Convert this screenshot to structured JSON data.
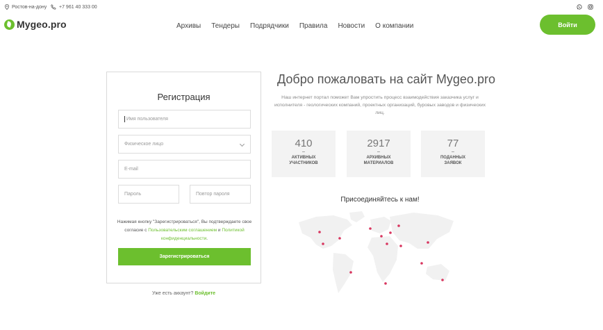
{
  "topbar": {
    "city": "Ростов-на-дону",
    "phone": "+7 961 40 333 00",
    "socials": [
      "whatsapp-icon",
      "instagram-icon"
    ]
  },
  "header": {
    "logo_text": "Mygeo.pro",
    "nav": [
      "Архивы",
      "Тендеры",
      "Подрядчики",
      "Правила",
      "Новости",
      "О компании"
    ],
    "login_label": "Войти"
  },
  "registration": {
    "title": "Регистрация",
    "username_placeholder": "Имя пользователя",
    "type_value": "Физическое лицо",
    "email_placeholder": "E-mail",
    "password_placeholder": "Пароль",
    "password_repeat_placeholder": "Повтор пароля",
    "agree_prefix": "Нажимая кнопку \"Зарегистрироваться\", Вы подтверждаете свое согласие с ",
    "agree_link1": "Пользовательским соглашением",
    "agree_mid": " и ",
    "agree_link2": "Политикой конфиденциальности",
    "agree_suffix": ".",
    "submit_label": "Зарегистрироваться",
    "have_account": "Уже есть аккаунт?",
    "login_link": "Войдите"
  },
  "welcome": {
    "title": "Добро пожаловать на сайт Mygeo.pro",
    "description": "Наш интернет портал поможет Вам упростить процесс взаимодействия заказчика услуг и исполнителя - геологических компаний, проектных организаций, буровых заводов и физических лиц.",
    "stats": [
      {
        "value": "410",
        "dash": "–",
        "label1": "активных",
        "label2": "участников"
      },
      {
        "value": "2917",
        "dash": "–",
        "label1": "архивных",
        "label2": "материалов"
      },
      {
        "value": "77",
        "dash": "–",
        "label1": "поданных",
        "label2": "заявок"
      }
    ],
    "join": "Присоединяйтесь к нам!"
  },
  "colors": {
    "accent": "#6cbf2e",
    "map_land": "#f1f1f1",
    "map_dot": "#d8365f"
  }
}
